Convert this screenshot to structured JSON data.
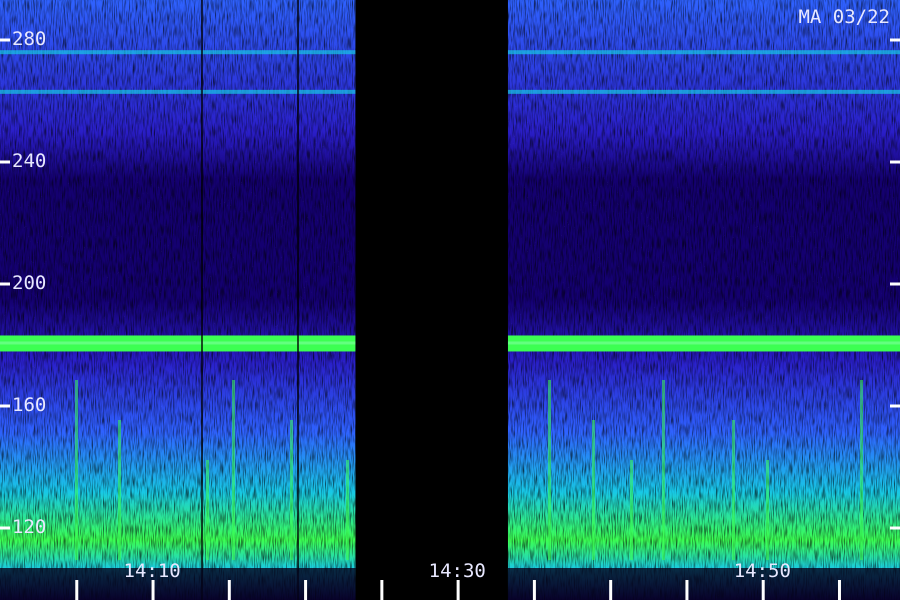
{
  "header": {
    "station": "MA 03/22"
  },
  "chart_data": {
    "type": "heatmap",
    "title": "",
    "xlabel": "",
    "ylabel": "",
    "x_ticks": [
      {
        "label": "14:10",
        "minute": 10
      },
      {
        "label": "14:30",
        "minute": 30
      },
      {
        "label": "14:50",
        "minute": 50
      }
    ],
    "x_minor_tick_step_minutes": 5,
    "x_range_minutes": [
      0,
      59
    ],
    "y_range": [
      110,
      292
    ],
    "y_ticks": [
      {
        "label": "120",
        "value": 120
      },
      {
        "label": "160",
        "value": 160
      },
      {
        "label": "200",
        "value": 200
      },
      {
        "label": "240",
        "value": 240
      },
      {
        "label": "280",
        "value": 280
      }
    ],
    "data_gap_minutes": [
      23.3,
      33.3
    ],
    "features": [
      {
        "kind": "steady_band",
        "y_value": 180.5,
        "intensity": "high"
      },
      {
        "kind": "band",
        "y_value": 276,
        "intensity": "medium"
      },
      {
        "kind": "band",
        "y_value": 263,
        "intensity": "medium"
      },
      {
        "kind": "broadband_noise",
        "y_range": [
          110,
          150
        ],
        "intensity": "high"
      }
    ],
    "colormap": [
      "#000000",
      "#140070",
      "#2a1ec8",
      "#2f62ff",
      "#18c8e6",
      "#3cff52"
    ]
  }
}
